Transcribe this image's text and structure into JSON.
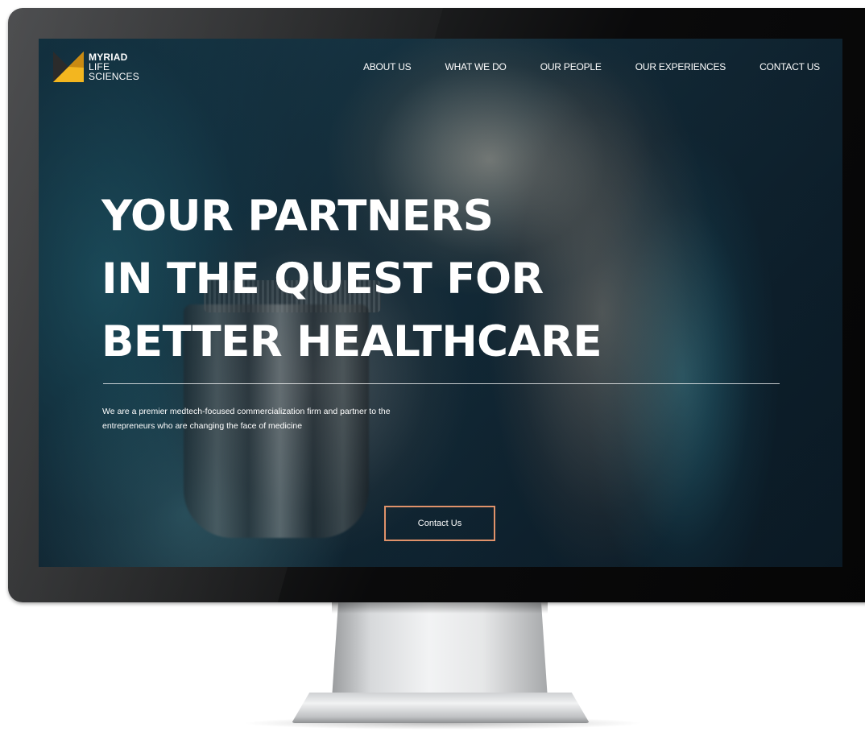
{
  "logo": {
    "line1": "MYRIAD",
    "line2": "LIFE",
    "line3": "SCIENCES",
    "icon": "myriad-logo-icon",
    "colors": [
      "#f3b61f",
      "#c98a12",
      "#2b2b2b"
    ]
  },
  "nav": {
    "items": [
      {
        "label": "ABOUT US"
      },
      {
        "label": "WHAT WE DO"
      },
      {
        "label": "OUR PEOPLE"
      },
      {
        "label": "OUR EXPERIENCES"
      },
      {
        "label": "CONTACT US"
      }
    ]
  },
  "hero": {
    "title_lines": [
      "YOUR PARTNERS",
      "IN THE QUEST FOR",
      "BETTER HEALTHCARE"
    ],
    "subtitle_lines": [
      "We are a premier medtech-focused commercialization firm and partner to the",
      "entrepreneurs who are changing the face of medicine"
    ],
    "cta_label": "Contact Us",
    "cta_border_color": "#e0926a"
  }
}
